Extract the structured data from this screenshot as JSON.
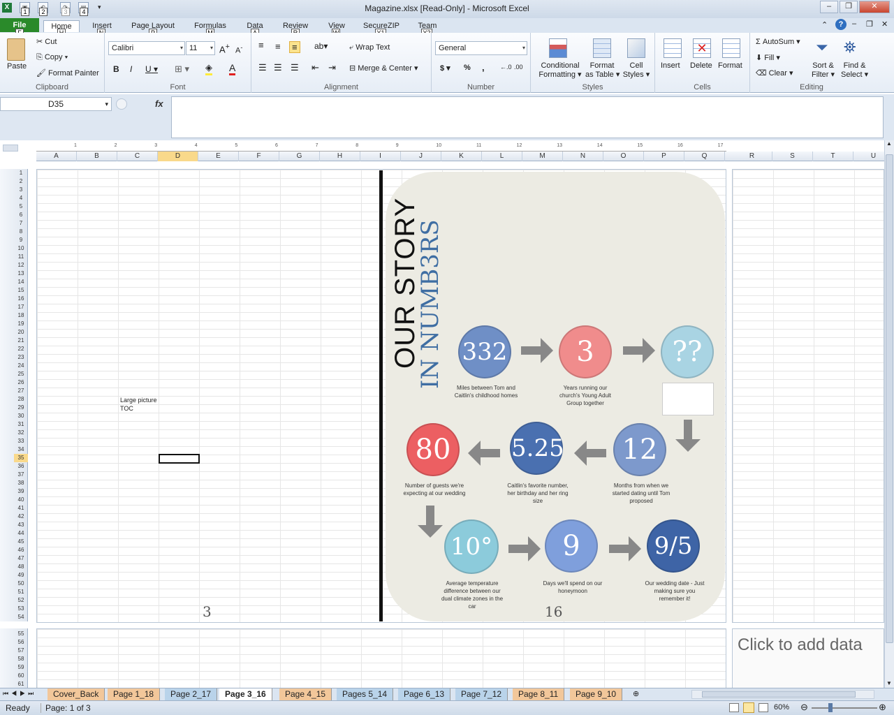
{
  "window": {
    "title": "Magazine.xlsx  [Read-Only]  -  Microsoft Excel"
  },
  "qat": {
    "key_badges": [
      "1",
      "2",
      "3",
      "4"
    ]
  },
  "tabs": [
    {
      "label": "File",
      "key": "F"
    },
    {
      "label": "Home",
      "key": "H"
    },
    {
      "label": "Insert",
      "key": "N"
    },
    {
      "label": "Page Layout",
      "key": "P"
    },
    {
      "label": "Formulas",
      "key": "M"
    },
    {
      "label": "Data",
      "key": "A"
    },
    {
      "label": "Review",
      "key": "R"
    },
    {
      "label": "View",
      "key": "W"
    },
    {
      "label": "SecureZIP",
      "key": "Y1"
    },
    {
      "label": "Team",
      "key": "Y2"
    }
  ],
  "ribbon": {
    "clipboard": {
      "label": "Clipboard",
      "paste": "Paste",
      "cut": "Cut",
      "copy": "Copy",
      "format_painter": "Format Painter"
    },
    "font": {
      "label": "Font",
      "name": "Calibri",
      "size": "11",
      "bold": "B",
      "italic": "I",
      "underline": "U"
    },
    "alignment": {
      "label": "Alignment",
      "wrap": "Wrap Text",
      "merge": "Merge & Center"
    },
    "number": {
      "label": "Number",
      "format": "General",
      "currency": "$",
      "percent": "%",
      "comma": ","
    },
    "styles": {
      "label": "Styles",
      "conditional": "Conditional",
      "conditional2": "Formatting",
      "format_table": "Format",
      "format_table2": "as Table",
      "cell_styles": "Cell",
      "cell_styles2": "Styles"
    },
    "cells": {
      "label": "Cells",
      "insert": "Insert",
      "delete": "Delete",
      "format": "Format"
    },
    "editing": {
      "label": "Editing",
      "autosum": "AutoSum",
      "fill": "Fill",
      "clear": "Clear",
      "sort": "Sort &",
      "sort2": "Filter",
      "find": "Find &",
      "find2": "Select"
    }
  },
  "formula_bar": {
    "name_box": "D35",
    "fx": "fx",
    "value": ""
  },
  "columns": [
    "A",
    "B",
    "C",
    "D",
    "E",
    "F",
    "G",
    "H",
    "I",
    "J",
    "K",
    "L",
    "M",
    "N",
    "O",
    "P",
    "Q",
    "R",
    "S",
    "T",
    "U"
  ],
  "ruler_marks": [
    "1",
    "2",
    "3",
    "4",
    "5",
    "6",
    "7",
    "8",
    "9",
    "10",
    "11",
    "12",
    "13",
    "14",
    "15",
    "16",
    "17"
  ],
  "sheet": {
    "cell_text": [
      "Large picture",
      "TOC"
    ],
    "page_num_left": "3",
    "page_num_right": "16",
    "click_to_add": "Click to add data"
  },
  "infographic": {
    "title": "OUR STORY",
    "subtitle": "IN NUMB3RS",
    "items": [
      {
        "value": "332",
        "caption": "Miles between Tom and Caitlin's childhood homes",
        "color": "#6f8fc6"
      },
      {
        "value": "3",
        "caption": "Years running our church's Young Adult Group together",
        "color": "#f08c8c"
      },
      {
        "value": "??",
        "caption": "",
        "color": "#a9d4e3"
      },
      {
        "value": "12",
        "caption": "Months from when we started dating until Tom proposed",
        "color": "#7d99cc"
      },
      {
        "value": "5.25",
        "caption": "Caitlin's favorite number, her birthday and her ring size",
        "color": "#4a70b0"
      },
      {
        "value": "80",
        "caption": "Number of guests we're expecting at our wedding",
        "color": "#ec5f62"
      },
      {
        "value": "10°",
        "caption": "Average temperature difference between our dual climate zones in the car",
        "color": "#8ccbdb"
      },
      {
        "value": "9",
        "caption": "Days we'll spend on our honeymoon",
        "color": "#7f9fdc"
      },
      {
        "value": "9/5",
        "caption": "Our wedding date - Just making sure you remember it!",
        "color": "#3e64a6"
      }
    ]
  },
  "sheet_tabs": [
    "Cover_Back",
    "Page 1_18",
    "Page 2_17",
    "Page 3_16",
    "Page 4_15",
    "Pages 5_14",
    "Page 6_13",
    "Page 7_12",
    "Page 8_11",
    "Page 9_10"
  ],
  "active_tab": "Page 3_16",
  "status": {
    "ready": "Ready",
    "page": "Page: 1 of 3",
    "zoom": "60%"
  }
}
